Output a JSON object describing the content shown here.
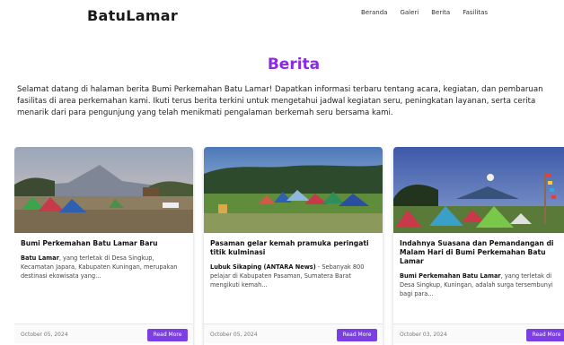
{
  "nav": {
    "brand": "BatuLamar",
    "links": [
      "Beranda",
      "Galeri",
      "Berita",
      "Fasilitas"
    ]
  },
  "page": {
    "title": "Berita",
    "intro": "Selamat datang di halaman berita Bumi Perkemahan Batu Lamar! Dapatkan informasi terbaru tentang acara, kegiatan, dan pembaruan fasilitas di area perkemahan kami. Ikuti terus berita terkini untuk mengetahui jadwal kegiatan seru, peningkatan layanan, serta cerita menarik dari para pengunjung yang telah menikmati pengalaman berkemah seru bersama kami."
  },
  "articles": [
    {
      "title": "Bumi Perkemahan Batu Lamar Baru",
      "lead": "Batu Lamar",
      "excerpt": ", yang terletak di Desa Singkup, Kecamatan Japara, Kabupaten Kuningan, merupakan destinasi ekowisata yang...",
      "date": "October 05, 2024",
      "button": "Read More"
    },
    {
      "title": "Pasaman gelar kemah pramuka peringati titik kulminasi",
      "lead": "Lubuk Sikaping (ANTARA News)",
      "excerpt": " - Sebanyak 800 pelajar di Kabupaten Pasaman, Sumatera Barat mengikuti kemah...",
      "date": "October 05, 2024",
      "button": "Read More"
    },
    {
      "title": "Indahnya Suasana dan Pemandangan di Malam Hari di Bumi Perkemahan Batu Lamar",
      "lead": "Bumi Perkemahan Batu Lamar",
      "excerpt": ", yang terletak di Desa Singkup, Kuningan, adalah surga tersembunyi bagi para...",
      "date": "October 03, 2024",
      "button": "Read More"
    }
  ],
  "colors": {
    "accent": "#7b3fe4",
    "title": "#8a2be2"
  }
}
